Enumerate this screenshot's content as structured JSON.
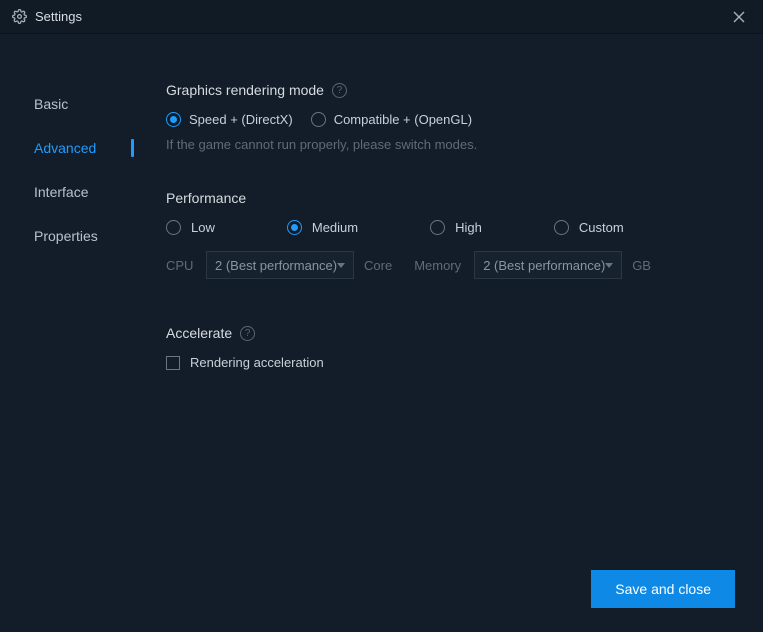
{
  "window": {
    "title": "Settings"
  },
  "sidebar": {
    "items": [
      {
        "label": "Basic",
        "active": false
      },
      {
        "label": "Advanced",
        "active": true
      },
      {
        "label": "Interface",
        "active": false
      },
      {
        "label": "Properties",
        "active": false
      }
    ]
  },
  "graphics": {
    "title": "Graphics rendering mode",
    "options": [
      {
        "label": "Speed + (DirectX)",
        "selected": true
      },
      {
        "label": "Compatible + (OpenGL)",
        "selected": false
      }
    ],
    "hint": "If the game cannot run properly, please switch modes."
  },
  "performance": {
    "title": "Performance",
    "options": [
      {
        "label": "Low",
        "selected": false
      },
      {
        "label": "Medium",
        "selected": true
      },
      {
        "label": "High",
        "selected": false
      },
      {
        "label": "Custom",
        "selected": false
      }
    ],
    "cpu": {
      "label": "CPU",
      "value": "2 (Best performance)",
      "unit": "Core"
    },
    "memory": {
      "label": "Memory",
      "value": "2 (Best performance)",
      "unit": "GB"
    }
  },
  "accelerate": {
    "title": "Accelerate",
    "rendering": {
      "label": "Rendering acceleration",
      "checked": false
    }
  },
  "footer": {
    "save": "Save and close"
  }
}
